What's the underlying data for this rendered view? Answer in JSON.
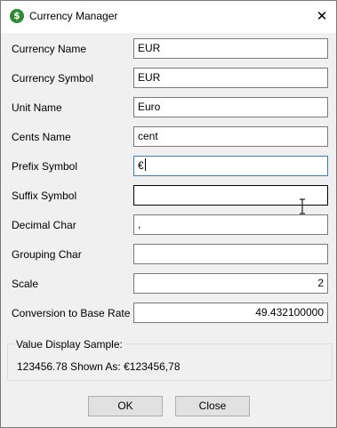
{
  "window": {
    "title": "Currency Manager",
    "app_icon_glyph": "$",
    "close_glyph": "✕"
  },
  "form": {
    "currency_name": {
      "label": "Currency Name",
      "value": "EUR"
    },
    "currency_symbol": {
      "label": "Currency Symbol",
      "value": "EUR"
    },
    "unit_name": {
      "label": "Unit Name",
      "value": "Euro"
    },
    "cents_name": {
      "label": "Cents Name",
      "value": "cent"
    },
    "prefix_symbol": {
      "label": "Prefix Symbol",
      "value": "€"
    },
    "suffix_symbol": {
      "label": "Suffix Symbol",
      "value": ""
    },
    "decimal_char": {
      "label": "Decimal Char",
      "value": ","
    },
    "grouping_char": {
      "label": "Grouping Char",
      "value": ""
    },
    "scale": {
      "label": "Scale",
      "value": "2"
    },
    "conversion_rate": {
      "label": "Conversion to Base Rate",
      "value": "49.432100000"
    }
  },
  "sample": {
    "legend": "Value Display Sample:",
    "text": "123456.78 Shown As: €123456,78"
  },
  "buttons": {
    "ok": "OK",
    "close": "Close"
  },
  "colors": {
    "focus_border": "#3c7fb1",
    "app_icon": "#2f8a34"
  }
}
